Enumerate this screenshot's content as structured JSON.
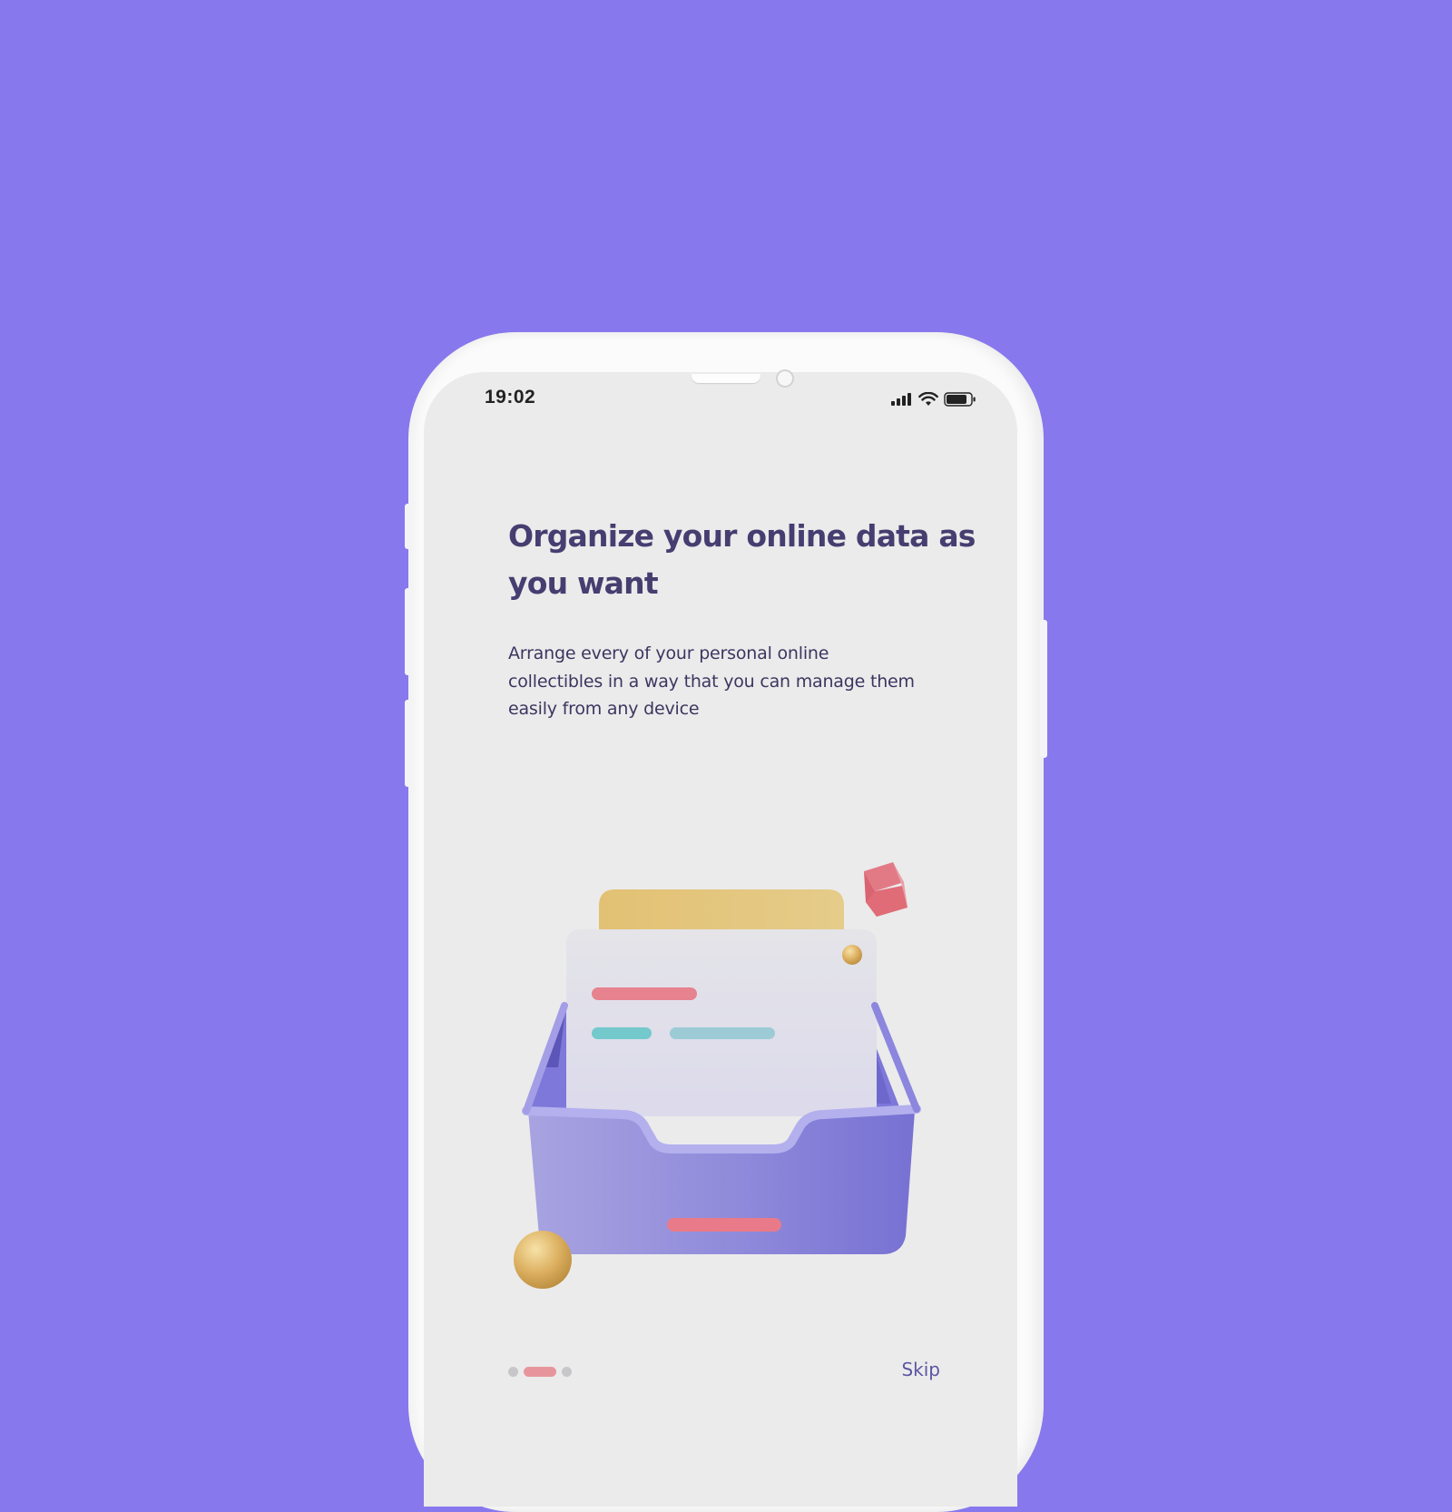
{
  "colors": {
    "background": "#8778ed",
    "screen": "#ebebeb",
    "headline": "#463e70",
    "body_text": "#3c3660",
    "pager_active": "#e7959c",
    "pager_inactive": "#c7c7c9",
    "skip": "#5b55a3"
  },
  "status_bar": {
    "time": "19:02",
    "icons": [
      "signal-icon",
      "wifi-icon",
      "battery-icon"
    ]
  },
  "onboarding": {
    "headline": "Organize your online data as you want",
    "description": "Arrange every of your personal online collectibles in a way that you can manage them easily from any device",
    "illustration": "file-tray-illustration",
    "pager": {
      "total": 3,
      "active_index": 1
    },
    "skip_label": "Skip"
  }
}
